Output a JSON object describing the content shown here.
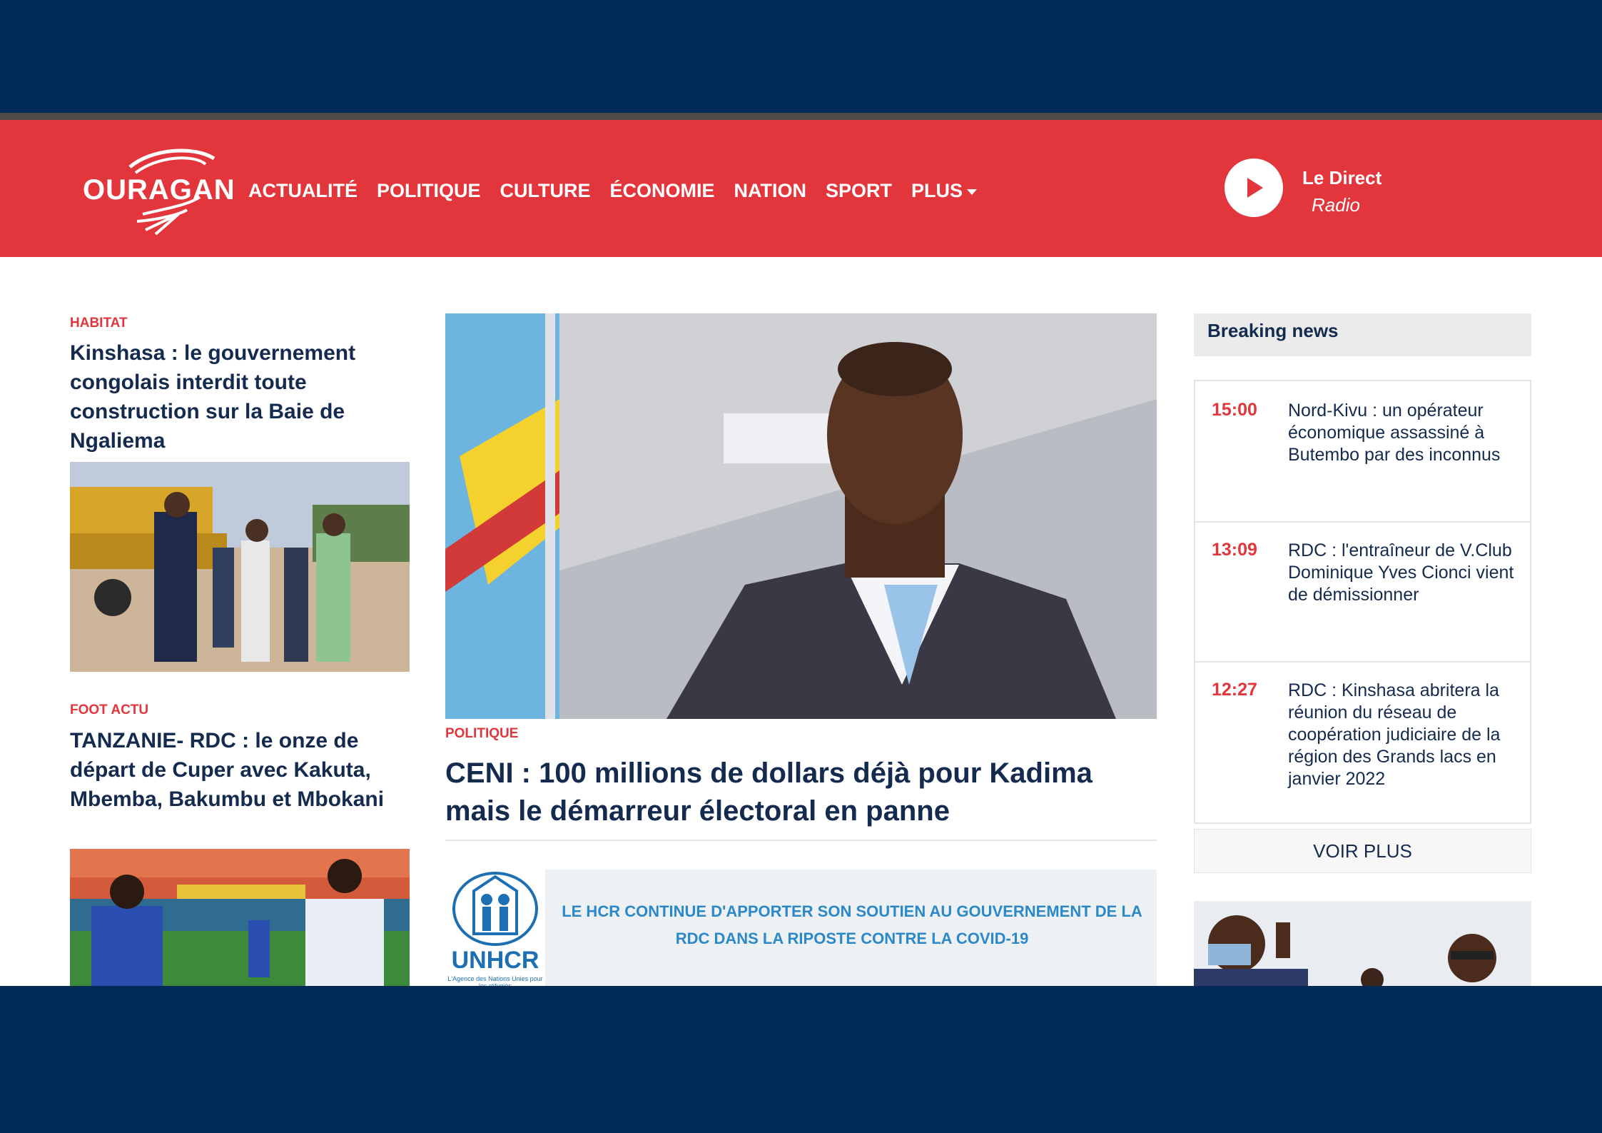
{
  "site": {
    "logo_text": "OURAGAN"
  },
  "nav": {
    "items": [
      "ACTUALITÉ",
      "POLITIQUE",
      "CULTURE",
      "ÉCONOMIE",
      "NATION",
      "SPORT"
    ],
    "more_label": "PLUS"
  },
  "live": {
    "title": "Le Direct",
    "subtitle": "Radio"
  },
  "left_articles": [
    {
      "category": "HABITAT",
      "title": "Kinshasa : le gouvernement congolais interdit toute construction sur la Baie de Ngaliema"
    },
    {
      "category": "FOOT ACTU",
      "title": "TANZANIE- RDC : le onze de départ de Cuper avec Kakuta, Mbemba, Bakumbu et Mbokani"
    }
  ],
  "hero": {
    "category": "POLITIQUE",
    "title": "CENI : 100 millions de dollars déjà pour Kadima mais le démarreur électoral en panne"
  },
  "ad": {
    "logo_text": "UNHCR",
    "logo_subtext": "L'Agence des Nations Unies pour les réfugiés",
    "text": "LE HCR CONTINUE D'APPORTER SON SOUTIEN AU GOUVERNEMENT DE LA RDC DANS LA RIPOSTE CONTRE LA COVID-19"
  },
  "breaking": {
    "heading": "Breaking news",
    "items": [
      {
        "time": "15:00",
        "text": "Nord-Kivu : un opérateur économique assassiné à Butembo par des inconnus"
      },
      {
        "time": "13:09",
        "text": "RDC : l'entraîneur de V.Club Dominique Yves Cionci vient de démissionner"
      },
      {
        "time": "12:27",
        "text": "RDC : Kinshasa abritera la réunion du réseau de coopération judiciaire de la région des Grands lacs en janvier 2022"
      }
    ],
    "more_label": "VOIR PLUS"
  },
  "colors": {
    "brand_red": "#e2363c",
    "navy_text": "#142b4f",
    "frame_navy": "#022a56"
  }
}
